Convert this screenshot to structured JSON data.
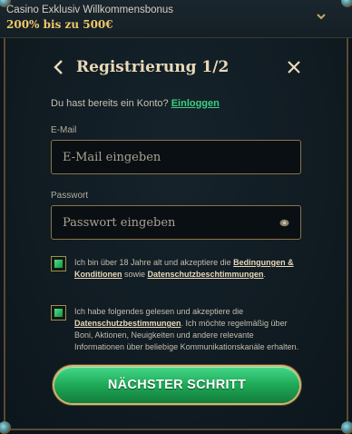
{
  "banner": {
    "title": "Casino Exklusiv Willkommensbonus",
    "bonus": "200% bis zu 500€"
  },
  "header": {
    "title": "Registrierung 1/2"
  },
  "login_prompt": {
    "text": "Du hast bereits ein Konto? ",
    "link": "Einloggen"
  },
  "email": {
    "label": "E-Mail",
    "placeholder": "E-Mail eingeben",
    "value": ""
  },
  "password": {
    "label": "Passwort",
    "placeholder": "Passwort eingeben",
    "value": ""
  },
  "consent_terms": {
    "checked": true,
    "text_1": "Ich bin über 18 Jahre alt und akzeptiere die ",
    "link_1": "Bedingungen & Konditionen",
    "text_2": " sowie ",
    "link_2": "Datenschutzbeschtimmungen",
    "text_3": "."
  },
  "consent_marketing": {
    "checked": true,
    "text_1": "Ich habe folgendes gelesen und akzeptiere die ",
    "link_1": "Datenschutzbestimmungen",
    "text_2": ". Ich möchte regelmäßig über Boni, Aktionen, Neuigkeiten und andere relevante Informationen über beliebige Kommunikationskanäle erhalten."
  },
  "next_button": {
    "label": "NÄCHSTER SCHRITT"
  },
  "colors": {
    "accent_gold": "#f0c96a",
    "link_green": "#3fcf82",
    "button_green": "#1ea957",
    "frame_gold": "#8d7447"
  }
}
